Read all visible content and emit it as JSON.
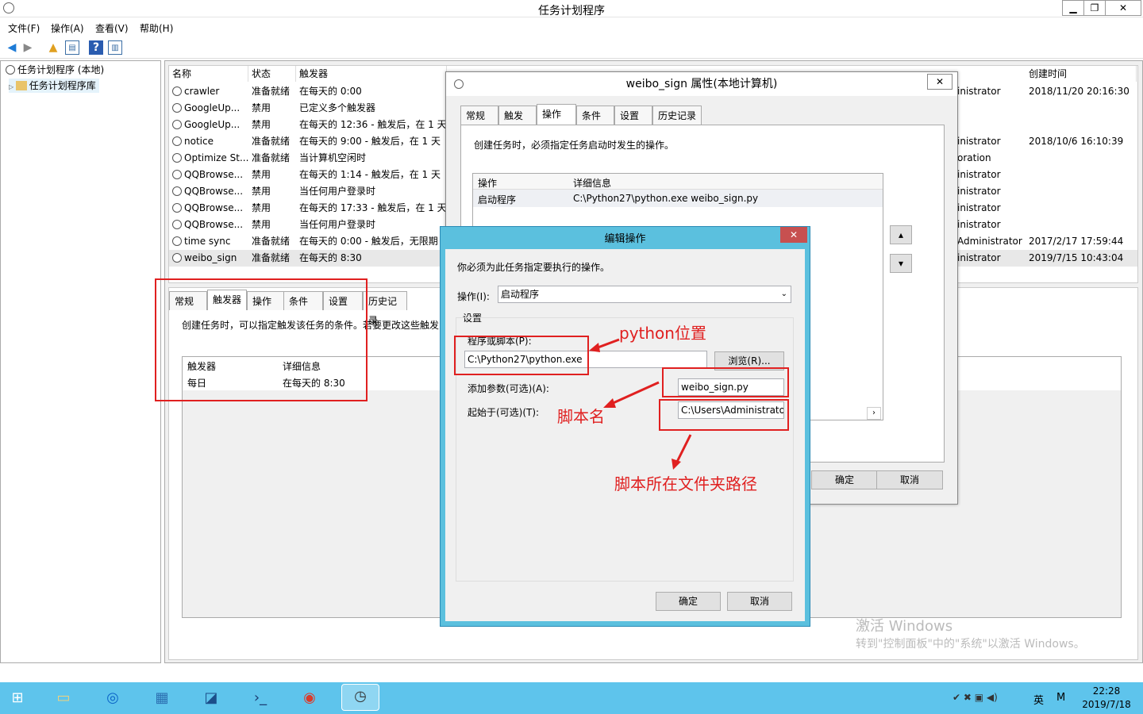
{
  "window": {
    "title": "任务计划程序"
  },
  "menu": [
    "文件(F)",
    "操作(A)",
    "查看(V)",
    "帮助(H)"
  ],
  "tree": {
    "root": "任务计划程序 (本地)",
    "child": "任务计划程序库"
  },
  "columns": [
    "名称",
    "状态",
    "触发器",
    "创建时间"
  ],
  "tasks": [
    {
      "name": "crawler",
      "status": "准备就绪",
      "trigger": "在每天的 0:00",
      "author": "inistrator",
      "created": "2018/11/20 20:16:30"
    },
    {
      "name": "GoogleUp...",
      "status": "禁用",
      "trigger": "已定义多个触发器",
      "author": "",
      "created": ""
    },
    {
      "name": "GoogleUp...",
      "status": "禁用",
      "trigger": "在每天的 12:36 - 触发后，在 1 天",
      "author": "",
      "created": ""
    },
    {
      "name": "notice",
      "status": "准备就绪",
      "trigger": "在每天的 9:00 - 触发后，在 1 天",
      "author": "inistrator",
      "created": "2018/10/6 16:10:39"
    },
    {
      "name": "Optimize St...",
      "status": "准备就绪",
      "trigger": "当计算机空闲时",
      "author": "oration",
      "created": ""
    },
    {
      "name": "QQBrowse...",
      "status": "禁用",
      "trigger": "在每天的 1:14 - 触发后，在 1 天",
      "author": "inistrator",
      "created": ""
    },
    {
      "name": "QQBrowse...",
      "status": "禁用",
      "trigger": "当任何用户登录时",
      "author": "inistrator",
      "created": ""
    },
    {
      "name": "QQBrowse...",
      "status": "禁用",
      "trigger": "在每天的 17:33 - 触发后，在 1 天",
      "author": "inistrator",
      "created": ""
    },
    {
      "name": "QQBrowse...",
      "status": "禁用",
      "trigger": "当任何用户登录时",
      "author": "inistrator",
      "created": ""
    },
    {
      "name": "time sync",
      "status": "准备就绪",
      "trigger": "在每天的 0:00 - 触发后，无限期",
      "author": "Administrator",
      "created": "2017/2/17 17:59:44"
    },
    {
      "name": "weibo_sign",
      "status": "准备就绪",
      "trigger": "在每天的 8:30",
      "author": "inistrator",
      "created": "2019/7/15 10:43:04"
    }
  ],
  "detail_tabs": [
    "常规",
    "触发器",
    "操作",
    "条件",
    "设置",
    "历史记录"
  ],
  "detail": {
    "desc": "创建任务时，可以指定触发该任务的条件。若要更改这些触发",
    "col1": "触发器",
    "col2": "详细信息",
    "row1": "每日",
    "row2": "在每天的 8:30"
  },
  "prop": {
    "title": "weibo_sign 属性(本地计算机)",
    "tabs": [
      "常规",
      "触发器",
      "操作",
      "条件",
      "设置",
      "历史记录"
    ],
    "desc": "创建任务时，必须指定任务启动时发生的操作。",
    "col1": "操作",
    "col2": "详细信息",
    "row_op": "启动程序",
    "row_detail": "C:\\Python27\\python.exe weibo_sign.py",
    "ok": "确定",
    "cancel": "取消"
  },
  "edit": {
    "title": "编辑操作",
    "desc": "你必须为此任务指定要执行的操作。",
    "op_label": "操作(I):",
    "op_value": "启动程序",
    "group": "设置",
    "prog_label": "程序或脚本(P):",
    "prog_value": "C:\\Python27\\python.exe",
    "browse": "浏览(R)...",
    "args_label": "添加参数(可选)(A):",
    "args_value": "weibo_sign.py",
    "start_label": "起始于(可选)(T):",
    "start_value": "C:\\Users\\Administrato",
    "ok": "确定",
    "cancel": "取消"
  },
  "annotations": {
    "python": "python位置",
    "script": "脚本名",
    "folder": "脚本所在文件夹路径"
  },
  "watermark": {
    "line1": "激活 Windows",
    "line2": "转到\"控制面板\"中的\"系统\"以激活 Windows。"
  },
  "clock": {
    "time": "22:28",
    "date": "2019/7/18"
  },
  "tray": {
    "lang": "英",
    "ime": "M"
  }
}
